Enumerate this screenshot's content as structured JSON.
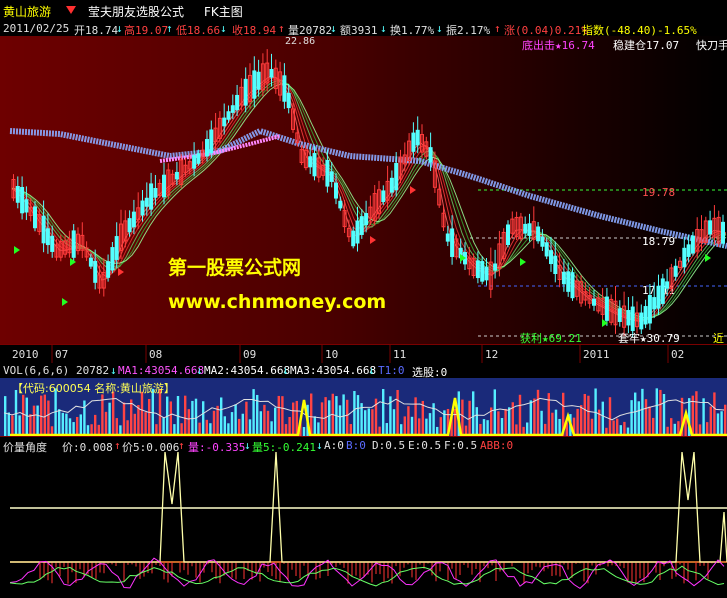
{
  "title_bar": {
    "stock_name": "黄山旅游",
    "formula_title": "莹夫朋友选股公式",
    "main_chart_label": "FK主图"
  },
  "info_bar": {
    "date": "2011/02/25",
    "open": "开18.74",
    "high": "高19.07",
    "low": "低18.66",
    "close": "收18.94",
    "volume": "量20782",
    "amount": "额3931",
    "turnover": "换1.77%",
    "amplitude": "振2.17%",
    "change": "涨(0.04)0.21%",
    "index": "指数(-48.40)-1.65%"
  },
  "main_chart": {
    "top_labels": [
      "底出击★16.74",
      "稳建仓17.07",
      "快刀手"
    ],
    "peak_price": "22.86",
    "level_labels": [
      "19.78",
      "18.79",
      "17.11"
    ],
    "bottom_labels": [
      "获利★69.21",
      "套牢★30.79",
      "近"
    ],
    "watermark_title": "第一股票公式网",
    "watermark_url": "www.chnmoney.com"
  },
  "date_axis": {
    "labels": [
      "2010",
      "07",
      "08",
      "09",
      "10",
      "11",
      "12",
      "2011",
      "02"
    ]
  },
  "vol_header": {
    "name": "VOL(6,6,6)",
    "vol": "20782",
    "ma1": "MA1:43054.668",
    "ma2": "MA2:43054.668",
    "ma3": "MA3:43054.668",
    "t1": "T1:0",
    "select": "选股:0"
  },
  "vol_panel": {
    "code_label": "【代码:600054 名称:黄山旅游】"
  },
  "angle_header": {
    "name": "价量角度",
    "price": "价:0.008",
    "price5": "价5:0.006",
    "vol": "量:-0.335",
    "vol5": "量5:-0.241",
    "a": "A:0",
    "b": "B:0",
    "d": "D:0.5",
    "e": "E:0.5",
    "f": "F:0.5",
    "abb": "ABB:0"
  },
  "colors": {
    "up": "#ff3b3b",
    "down": "#54ffff",
    "white": "#ffffff",
    "yellow": "#ffff00",
    "magenta": "#ff00ff",
    "green": "#00ff00",
    "blue": "#5a6bff"
  }
}
